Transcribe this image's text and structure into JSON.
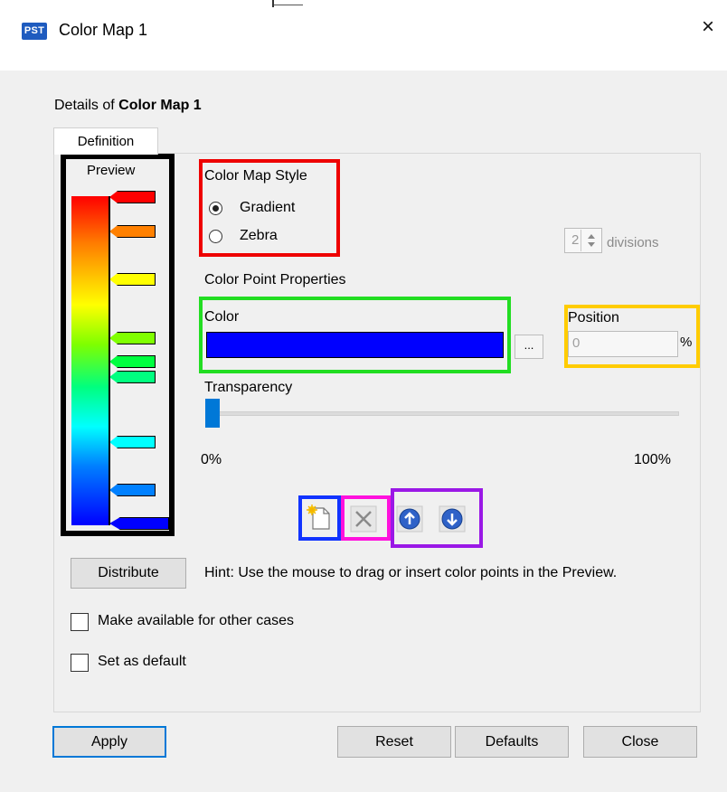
{
  "window": {
    "title": "Color Map 1",
    "app_icon": "PST",
    "close_glyph": "×"
  },
  "header": {
    "details_prefix": "Details of ",
    "details_name": "Color Map 1"
  },
  "tabs": [
    {
      "label": "Definition",
      "active": true
    }
  ],
  "preview": {
    "label": "Preview",
    "gradient_stops": [
      "#ff0000",
      "#ff7a00",
      "#ffff00",
      "#7fff00",
      "#00ff7f",
      "#00ffff",
      "#007fff",
      "#0000ff"
    ],
    "color_points": [
      "#ff0000",
      "#ff8000",
      "#ffff00",
      "#80ff00",
      "#00ff40",
      "#00ff80",
      "#00ffff",
      "#0080ff",
      "#0000ff"
    ]
  },
  "style": {
    "heading": "Color Map Style",
    "options": [
      {
        "label": "Gradient",
        "selected": true
      },
      {
        "label": "Zebra",
        "selected": false
      }
    ],
    "divisions_value": "2",
    "divisions_label": "divisions"
  },
  "color_point": {
    "heading": "Color Point Properties",
    "color_label": "Color",
    "color_value": "#0000ff",
    "browse_label": "...",
    "position_label": "Position",
    "position_value": "0",
    "position_unit": "%",
    "transparency_label": "Transparency",
    "transparency_value": 0,
    "transparency_min": "0%",
    "transparency_max": "100%"
  },
  "toolbar": {
    "icons": [
      "new-point-icon",
      "delete-point-icon",
      "move-up-icon",
      "move-down-icon"
    ]
  },
  "distribute_label": "Distribute",
  "hint": "Hint: Use the mouse to drag or insert color points in the Preview.",
  "checkboxes": [
    {
      "label": "Make available for other cases",
      "checked": false
    },
    {
      "label": "Set as default",
      "checked": false
    }
  ],
  "buttons": {
    "apply": "Apply",
    "reset": "Reset",
    "defaults": "Defaults",
    "close": "Close"
  }
}
